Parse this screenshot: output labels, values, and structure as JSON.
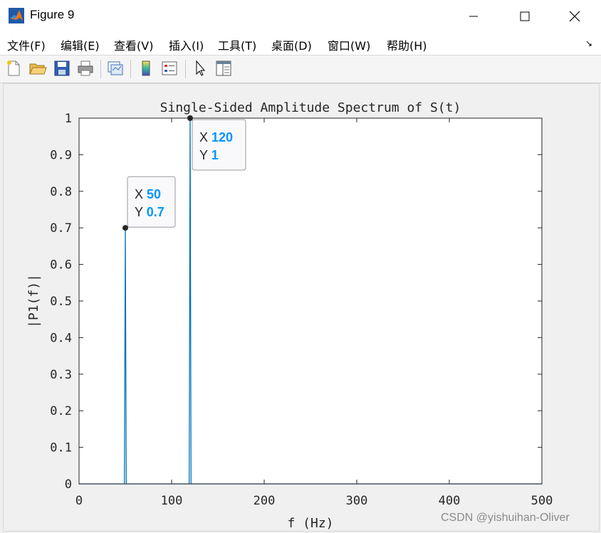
{
  "window": {
    "title": "Figure 9"
  },
  "menu": [
    "文件(F)",
    "编辑(E)",
    "查看(V)",
    "插入(I)",
    "工具(T)",
    "桌面(D)",
    "窗口(W)",
    "帮助(H)"
  ],
  "toolbar_icons": [
    "new-figure-icon",
    "open-file-icon",
    "save-icon",
    "print-icon",
    "link-plot-icon",
    "colorbar-icon",
    "legend-icon",
    "pointer-icon",
    "property-editor-icon"
  ],
  "colors": {
    "line": "#0072bd",
    "datatip_value": "#0096ff"
  },
  "chart_data": {
    "type": "line",
    "title": "Single-Sided Amplitude Spectrum of S(t)",
    "xlabel": "f (Hz)",
    "ylabel": "|P1(f)|",
    "xlim": [
      0,
      500
    ],
    "ylim": [
      0,
      1
    ],
    "xticks": [
      "0",
      "100",
      "200",
      "300",
      "400",
      "500"
    ],
    "yticks": [
      "0",
      "0.1",
      "0.2",
      "0.3",
      "0.4",
      "0.5",
      "0.6",
      "0.7",
      "0.8",
      "0.9",
      "1"
    ],
    "grid": false,
    "series": [
      {
        "x": [
          0,
          49,
          50,
          51,
          119,
          120,
          121,
          500
        ],
        "y": [
          0,
          0,
          0.7,
          0,
          0,
          1,
          0,
          0
        ]
      }
    ],
    "datatips": [
      {
        "x_label": "X",
        "x_value": "50",
        "y_label": "Y",
        "y_value": "0.7",
        "x": 50,
        "y": 0.7
      },
      {
        "x_label": "X",
        "x_value": "120",
        "y_label": "Y",
        "y_value": "1",
        "x": 120,
        "y": 1
      }
    ]
  },
  "watermark": "CSDN @yishuihan-Oliver"
}
